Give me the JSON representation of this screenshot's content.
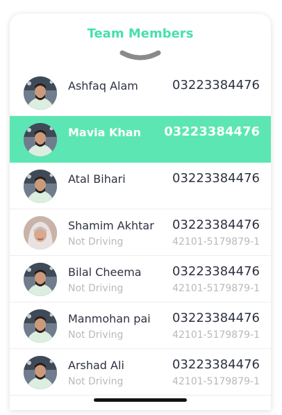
{
  "header": {
    "title": "Team Members",
    "handle_icon": "chevron-down-icon"
  },
  "colors": {
    "accent": "#47e0ad",
    "selected_row": "#5ce6b3",
    "text": "#2d3142",
    "muted": "#b9b9b9"
  },
  "members": [
    {
      "name": "Ashfaq Alam",
      "phone": "03223384476",
      "status": "",
      "cnic": "",
      "avatar": "man",
      "selected": false
    },
    {
      "name": "Mavia Khan",
      "phone": "03223384476",
      "status": "",
      "cnic": "",
      "avatar": "man",
      "selected": true
    },
    {
      "name": "Atal Bihari",
      "phone": "03223384476",
      "status": "",
      "cnic": "",
      "avatar": "man",
      "selected": false
    },
    {
      "name": "Shamim Akhtar",
      "phone": "03223384476",
      "status": "Not Driving",
      "cnic": "42101-5179879-1",
      "avatar": "woman",
      "selected": false
    },
    {
      "name": "Bilal Cheema",
      "phone": "03223384476",
      "status": "Not Driving",
      "cnic": "42101-5179879-1",
      "avatar": "man",
      "selected": false
    },
    {
      "name": "Manmohan pai",
      "phone": "03223384476",
      "status": "Not Driving",
      "cnic": "42101-5179879-1",
      "avatar": "man",
      "selected": false
    },
    {
      "name": "Arshad Ali",
      "phone": "03223384476",
      "status": "Not Driving",
      "cnic": "42101-5179879-1",
      "avatar": "man",
      "selected": false
    }
  ]
}
